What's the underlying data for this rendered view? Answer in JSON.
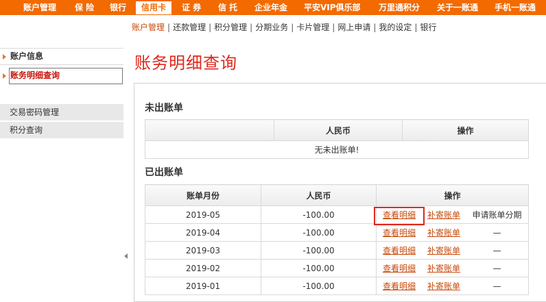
{
  "topnav": {
    "items": [
      {
        "label": "账户管理"
      },
      {
        "label": "保 险"
      },
      {
        "label": "银行"
      },
      {
        "label": "信用卡"
      },
      {
        "label": "证 券"
      },
      {
        "label": "信 托"
      },
      {
        "label": "企业年金"
      },
      {
        "label": "平安VIP俱乐部"
      },
      {
        "label": "万里通积分"
      },
      {
        "label": "关于一账通"
      },
      {
        "label": "手机一账通"
      }
    ],
    "active_index": 3
  },
  "subnav": {
    "items": [
      "账户管理",
      "还款管理",
      "积分管理",
      "分期业务",
      "卡片管理",
      "网上申请",
      "我的设定",
      "银行"
    ],
    "separator": "|"
  },
  "sidebar": {
    "sections": [
      "账户信息",
      "账务明细查询"
    ],
    "links": [
      "交易密码管理",
      "积分查询"
    ]
  },
  "page_title": "账务明细查询",
  "unbilled": {
    "title": "未出账单",
    "headers": [
      "",
      "人民币",
      "操作"
    ],
    "empty_message": "无未出账单!"
  },
  "billed": {
    "title": "已出账单",
    "headers": [
      "账单月份",
      "人民币",
      "操作"
    ],
    "rows": [
      {
        "month": "2019-05",
        "amount": "-100.00",
        "view": "查看明细",
        "resend": "补寄账单",
        "installment": "申请账单分期"
      },
      {
        "month": "2019-04",
        "amount": "-100.00",
        "view": "查看明细",
        "resend": "补寄账单",
        "installment": "—"
      },
      {
        "month": "2019-03",
        "amount": "-100.00",
        "view": "查看明细",
        "resend": "补寄账单",
        "installment": "—"
      },
      {
        "month": "2019-02",
        "amount": "-100.00",
        "view": "查看明细",
        "resend": "补寄账单",
        "installment": "—"
      },
      {
        "month": "2019-01",
        "amount": "-100.00",
        "view": "查看明细",
        "resend": "补寄账单",
        "installment": "—"
      }
    ]
  }
}
